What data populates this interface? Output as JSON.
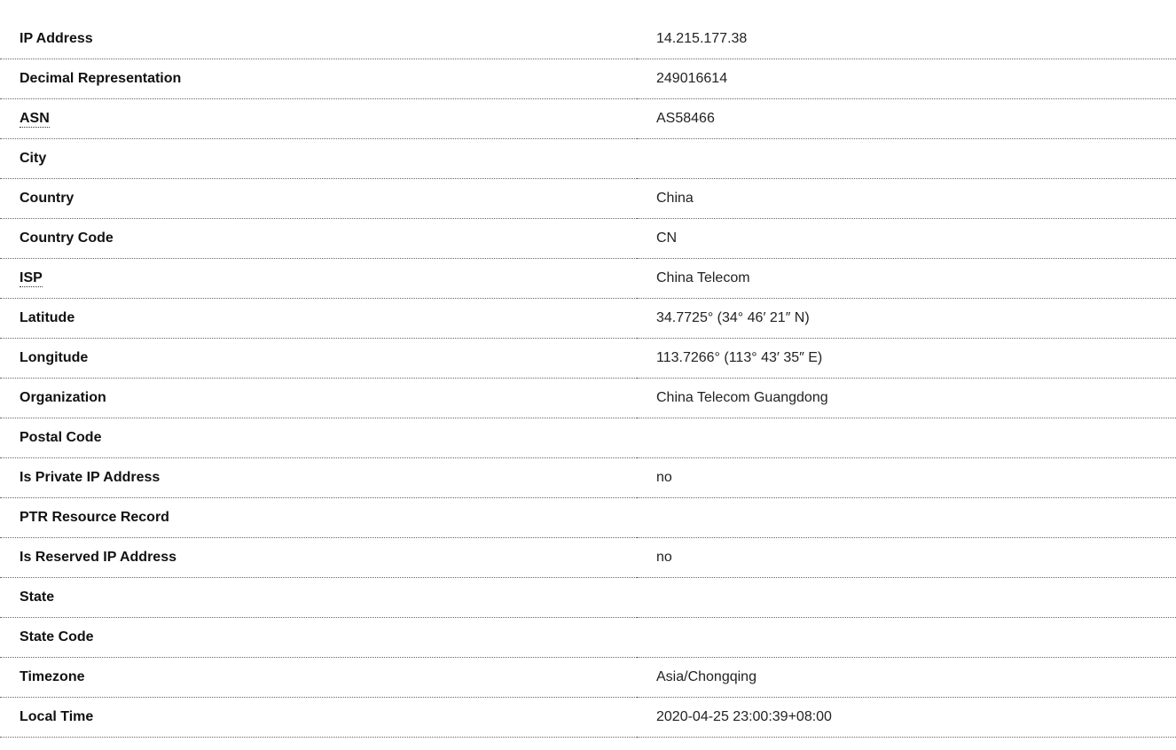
{
  "table": {
    "rows": [
      {
        "label": "IP Address",
        "value": "14.215.177.38",
        "abbr": false
      },
      {
        "label": "Decimal Representation",
        "value": "249016614",
        "abbr": false
      },
      {
        "label": "ASN",
        "value": "AS58466",
        "abbr": true
      },
      {
        "label": "City",
        "value": "",
        "abbr": false
      },
      {
        "label": "Country",
        "value": "China",
        "abbr": false
      },
      {
        "label": "Country Code",
        "value": "CN",
        "abbr": false
      },
      {
        "label": "ISP",
        "value": "China Telecom",
        "abbr": true
      },
      {
        "label": "Latitude",
        "value": "34.7725° (34° 46′ 21″ N)",
        "abbr": false
      },
      {
        "label": "Longitude",
        "value": "113.7266° (113° 43′ 35″ E)",
        "abbr": false
      },
      {
        "label": "Organization",
        "value": "China Telecom Guangdong",
        "abbr": false
      },
      {
        "label": "Postal Code",
        "value": "",
        "abbr": false
      },
      {
        "label": "Is Private IP Address",
        "value": "no",
        "abbr": false
      },
      {
        "label": "PTR Resource Record",
        "value": "",
        "abbr": false
      },
      {
        "label": "Is Reserved IP Address",
        "value": "no",
        "abbr": false
      },
      {
        "label": "State",
        "value": "",
        "abbr": false
      },
      {
        "label": "State Code",
        "value": "",
        "abbr": false
      },
      {
        "label": "Timezone",
        "value": "Asia/Chongqing",
        "abbr": false
      },
      {
        "label": "Local Time",
        "value": "2020-04-25 23:00:39+08:00",
        "abbr": false
      }
    ]
  },
  "colors": {
    "background": "#ffffff",
    "label_text": "#111111",
    "value_text": "#222222",
    "row_divider": "#666666"
  }
}
